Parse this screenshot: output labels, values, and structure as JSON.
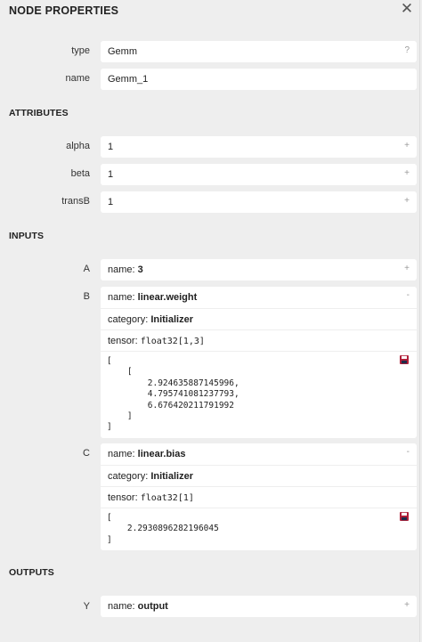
{
  "header": {
    "title": "NODE PROPERTIES",
    "close_glyph": "✕"
  },
  "node": {
    "type_label": "type",
    "type_value": "Gemm",
    "type_btn": "?",
    "name_label": "name",
    "name_value": "Gemm_1"
  },
  "attributes": {
    "heading": "ATTRIBUTES",
    "items": [
      {
        "label": "alpha",
        "value": "1",
        "btn": "+"
      },
      {
        "label": "beta",
        "value": "1",
        "btn": "+"
      },
      {
        "label": "transB",
        "value": "1",
        "btn": "+"
      }
    ]
  },
  "inputs": {
    "heading": "INPUTS",
    "A": {
      "label": "A",
      "name_key": "name: ",
      "name_value": "3",
      "btn": "+"
    },
    "B": {
      "label": "B",
      "name_key": "name: ",
      "name_value": "linear.weight",
      "btn": "-",
      "category_key": "category: ",
      "category_value": "Initializer",
      "tensor_key": "tensor: ",
      "tensor_value": "float32[1,3]",
      "data": "[\n    [\n        2.924635887145996,\n        4.795741081237793,\n        6.676420211791992\n    ]\n]"
    },
    "C": {
      "label": "C",
      "name_key": "name: ",
      "name_value": "linear.bias",
      "btn": "-",
      "category_key": "category: ",
      "category_value": "Initializer",
      "tensor_key": "tensor: ",
      "tensor_value": "float32[1]",
      "data": "[\n    2.2930896282196045\n]"
    }
  },
  "outputs": {
    "heading": "OUTPUTS",
    "Y": {
      "label": "Y",
      "name_key": "name: ",
      "name_value": "output",
      "btn": "+"
    }
  },
  "colors": {
    "background": "#eeeeee",
    "box": "#ffffff",
    "save_icon": "#b0203a"
  }
}
